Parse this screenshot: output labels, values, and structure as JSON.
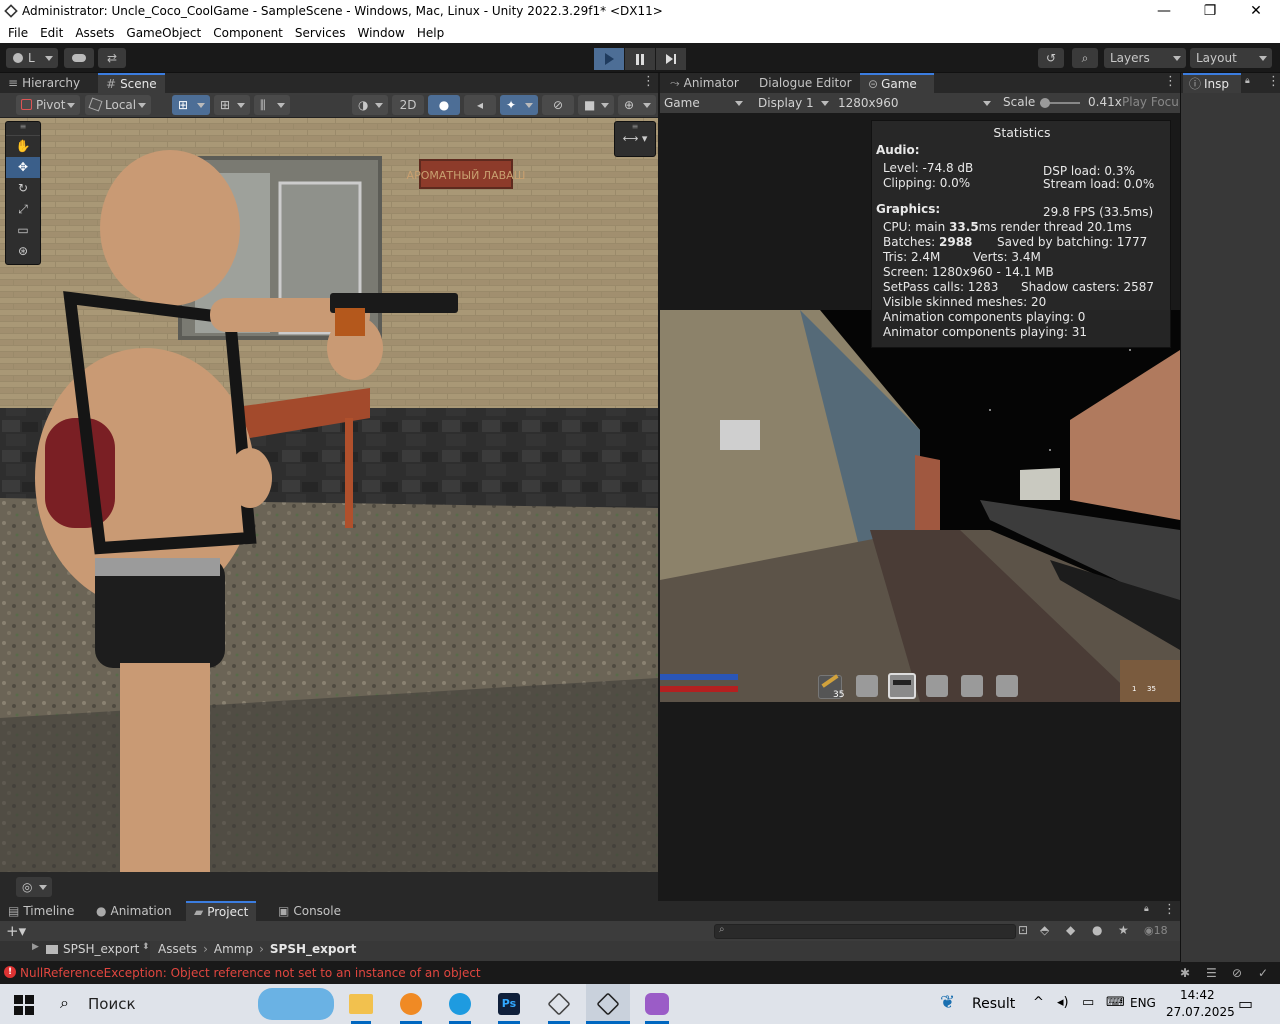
{
  "window": {
    "title": "Administrator: Uncle_Coco_CoolGame - SampleScene - Windows, Mac, Linux - Unity 2022.3.29f1* <DX11>",
    "minimize": "—",
    "maximize": "❐",
    "close": "✕"
  },
  "menu": [
    "File",
    "Edit",
    "Assets",
    "GameObject",
    "Component",
    "Services",
    "Window",
    "Help"
  ],
  "toolbar": {
    "account": "L",
    "layers": "Layers",
    "layout": "Layout"
  },
  "tabs_left": {
    "hierarchy": "Hierarchy",
    "scene": "Scene"
  },
  "scene_toolbar": {
    "pivot": "Pivot",
    "local": "Local",
    "mode2d": "2D"
  },
  "scene_sign": "АРОМАТНЫЙ ЛАВАШ",
  "tabs_center": {
    "animator": "Animator",
    "dialogue": "Dialogue Editor",
    "game": "Game"
  },
  "tabs_right": {
    "inspector": "Insp"
  },
  "game_toolbar": {
    "game": "Game",
    "display": "Display 1",
    "resolution": "1280x960",
    "scale_label": "Scale",
    "scale_value": "0.41x",
    "play_focus": "Play Focu"
  },
  "stats": {
    "title": "Statistics",
    "audio": "Audio:",
    "level": "Level: -74.8 dB",
    "clipping": "Clipping: 0.0%",
    "dsp": "DSP load: 0.3%",
    "stream": "Stream load: 0.0%",
    "graphics": "Graphics:",
    "fps": "29.8 FPS (33.5ms)",
    "cpu_pre": "CPU: main ",
    "cpu_main": "33.5",
    "cpu_post": "ms  render thread 20.1ms",
    "batches_pre": "Batches: ",
    "batches": "2988",
    "saved": "Saved by batching: 1777",
    "tris": "Tris: 2.4M",
    "verts": "Verts: 3.4M",
    "screen": "Screen: 1280x960 - 14.1 MB",
    "setpass": "SetPass calls: 1283",
    "shadow": "Shadow casters: 2587",
    "skinned": "Visible skinned meshes: 20",
    "anim": "Animation components playing: 0",
    "animator": "Animator components playing: 31"
  },
  "hud": {
    "ammo_slot": "35",
    "ammo_a": "1",
    "ammo_b": "35"
  },
  "bottom_tabs": {
    "timeline": "Timeline",
    "animation": "Animation",
    "project": "Project",
    "console": "Console"
  },
  "project": {
    "folder": "SPSH_export",
    "crumbs": [
      "Assets",
      "Ammp",
      "SPSH_export"
    ],
    "search_placeholder": "",
    "hidden_count": "18"
  },
  "status": {
    "error": "NullReferenceException: Object reference not set to an instance of an object"
  },
  "taskbar": {
    "search": "Поиск",
    "result": "Result",
    "lang": "ENG",
    "time": "14:42",
    "date": "27.07.2025"
  }
}
